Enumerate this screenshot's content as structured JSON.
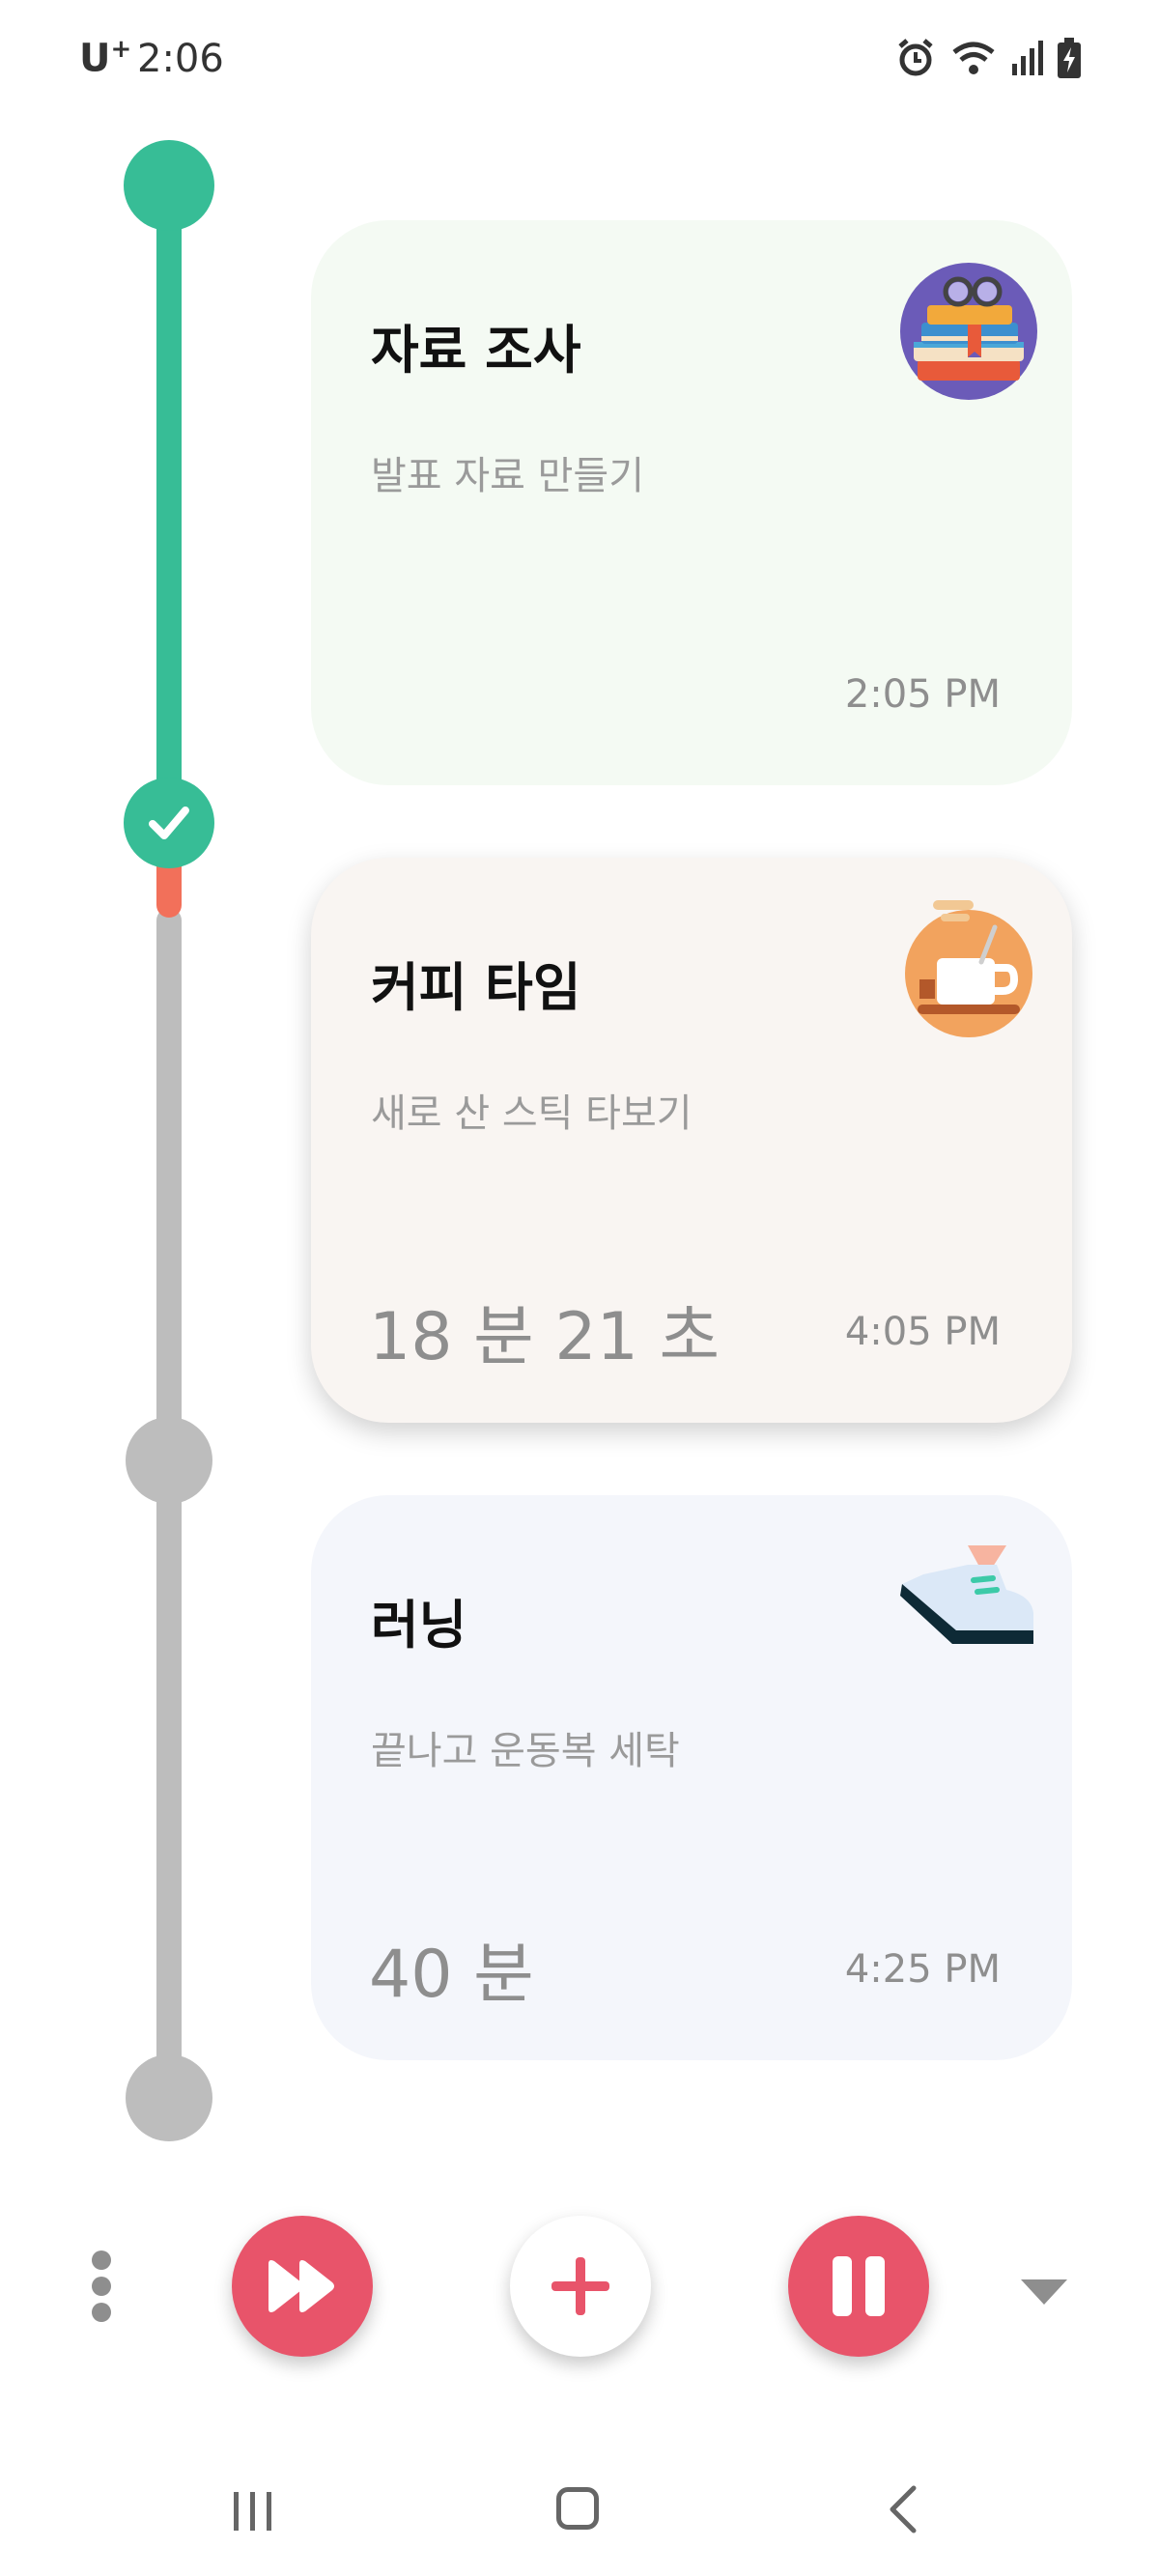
{
  "status_bar": {
    "carrier": "U",
    "carrier_sup": "+",
    "time": "2:06",
    "icons": [
      "alarm-icon",
      "wifi-icon",
      "signal-icon",
      "battery-charging-icon"
    ]
  },
  "tasks": [
    {
      "title": "자료 조사",
      "subtitle": "발표 자료 만들기",
      "time": "2:05 PM",
      "duration": "",
      "icon": "books-glasses-icon",
      "state": "done"
    },
    {
      "title": "커피 타임",
      "subtitle": "새로 산 스틱 타보기",
      "time": "4:05 PM",
      "duration": "18 분 21 초",
      "icon": "coffee-cup-icon",
      "state": "active"
    },
    {
      "title": "러닝",
      "subtitle": "끝나고 운동복 세탁",
      "time": "4:25 PM",
      "duration": "40 분",
      "icon": "sneaker-icon",
      "state": "pending"
    }
  ],
  "controls": {
    "more": "more-vert-icon",
    "skip": "fast-forward-icon",
    "add": "plus-icon",
    "pause": "pause-icon",
    "collapse": "chevron-down-icon"
  },
  "nav_bar": {
    "recent": "recent-apps-icon",
    "home": "home-icon",
    "back": "back-icon"
  },
  "colors": {
    "accent_green": "#37bd96",
    "accent_red": "#e8546a",
    "timeline_grey": "#bdbdbd",
    "progress_orange": "#f2705a"
  }
}
